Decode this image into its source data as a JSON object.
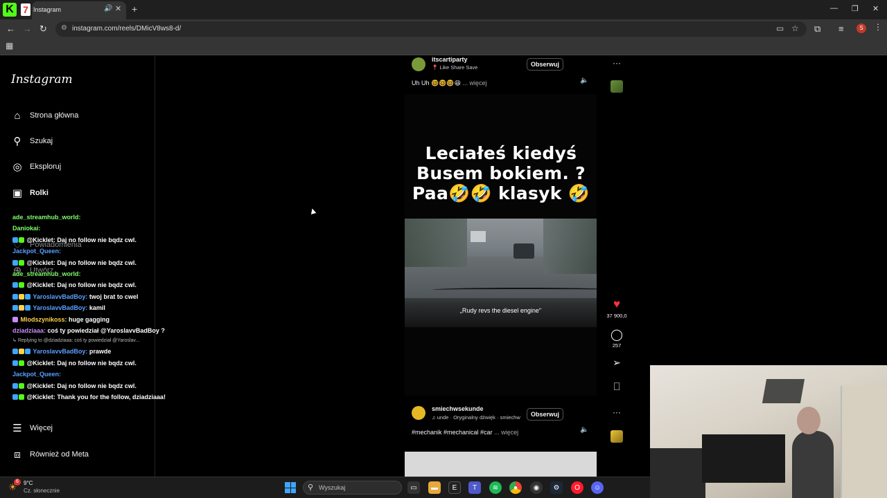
{
  "browser": {
    "tab_title": "Instagram",
    "url": "instagram.com/reels/DMicV8ws8-d/",
    "profile_initial": "S"
  },
  "sidebar": {
    "logo": "Instagram",
    "items": [
      {
        "label": "Strona główna",
        "icon": "home-icon"
      },
      {
        "label": "Szukaj",
        "icon": "search-icon"
      },
      {
        "label": "Eksploruj",
        "icon": "compass-icon"
      },
      {
        "label": "Rolki",
        "icon": "reels-icon"
      },
      {
        "label": "Powiadomienia",
        "icon": "heart-icon"
      },
      {
        "label": "Utwórz",
        "icon": "plus-icon"
      },
      {
        "label": "Więcej",
        "icon": "menu-icon"
      },
      {
        "label": "Również od Meta",
        "icon": "meta-icon"
      }
    ]
  },
  "chat": [
    {
      "user": "ade_streamhub_world:",
      "msg": "",
      "color": "#7fff6a"
    },
    {
      "user": "Daniokai:",
      "msg": "",
      "color": "#7fff6a"
    },
    {
      "user": "@Kicklet:",
      "msg": "Daj no follow nie bqdz cwl.",
      "color": "#ffffff"
    },
    {
      "user": "Jackpot_Queen:",
      "msg": "",
      "color": "#5aa0ff"
    },
    {
      "user": "@Kicklet:",
      "msg": "Daj no follow nie bqdz cwl.",
      "color": "#ffffff"
    },
    {
      "user": "ade_streamhub_world:",
      "msg": "",
      "color": "#7fff6a"
    },
    {
      "user": "@Kicklet:",
      "msg": "Daj no follow nie bqdz cwl.",
      "color": "#ffffff"
    },
    {
      "user": "YaroslavvBadBoy:",
      "msg": "twoj brat to cwel",
      "color": "#5aa0ff"
    },
    {
      "user": "YaroslavvBadBoy:",
      "msg": "kamil",
      "color": "#5aa0ff"
    },
    {
      "user": "Mlodszynikoss:",
      "msg": "huge gagging",
      "color": "#ffd24a"
    },
    {
      "user": "dziadziaaa:",
      "msg": "coś ty powiedział @YaroslavvBadBoy ?",
      "color": "#c88bff"
    },
    {
      "user": "",
      "msg": "Replying to @dziadziaaa: coś ty powiedział @Yaroslav...",
      "color": "#bbbbbb",
      "reply": true
    },
    {
      "user": "YaroslavvBadBoy:",
      "msg": "prawde",
      "color": "#5aa0ff"
    },
    {
      "user": "@Kicklet:",
      "msg": "Daj no follow nie bqdz cwl.",
      "color": "#ffffff"
    },
    {
      "user": "Jackpot_Queen:",
      "msg": "",
      "color": "#5aa0ff"
    },
    {
      "user": "@Kicklet:",
      "msg": "Daj no follow nie bqdz cwl.",
      "color": "#ffffff"
    },
    {
      "user": "@Kicklet:",
      "msg": "Thank you for the follow, dziadziaaa!",
      "color": "#ffffff"
    }
  ],
  "reel_top": {
    "username": "itscartiparty",
    "audio": "Like Share Save",
    "follow": "Obserwuj",
    "caption": "Uh Uh 🤓🤓🤓😆",
    "more": "... więcej"
  },
  "reel_main": {
    "overlay_text": "Leciałeś kiedyś Busem bokiem. ? Paa🤣🤣 klasyk 🤣",
    "subtitle": "„Rudy revs the diesel engine\""
  },
  "actions": {
    "likes": "37 900,0",
    "comments": "257"
  },
  "reel_next": {
    "username": "smiechwsekunde",
    "audio": "unde · Oryginalny dźwięk · smiechw",
    "follow": "Obserwuj",
    "caption": "#mechanik #mechanical #car",
    "more": "... więcej"
  },
  "taskbar": {
    "temperature": "9°C",
    "condition": "Cz. słonecznie",
    "weather_badge": "6",
    "search_placeholder": "Wyszukaj"
  }
}
